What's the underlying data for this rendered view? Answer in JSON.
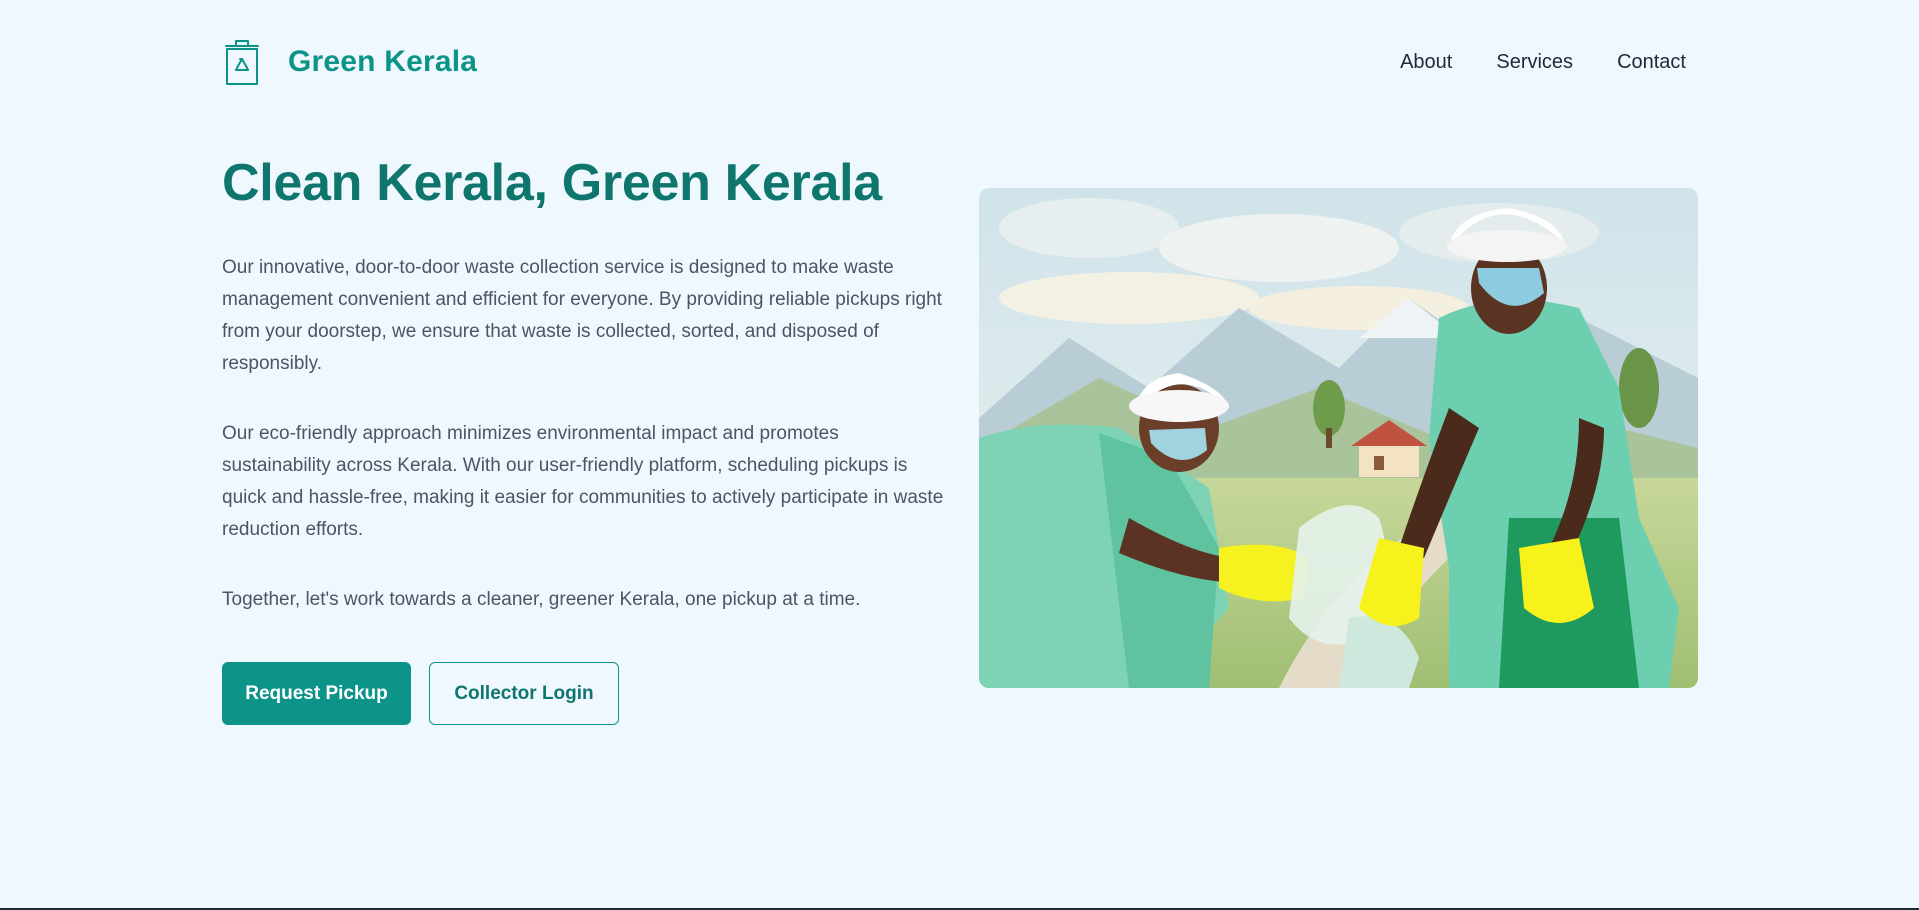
{
  "brand": {
    "name": "Green Kerala",
    "icon": "recycle-bin-icon",
    "color": "#0d9488"
  },
  "nav": {
    "items": [
      "About",
      "Services",
      "Contact"
    ]
  },
  "hero": {
    "title": "Clean Kerala, Green Kerala",
    "paragraphs": [
      "Our innovative, door-to-door waste collection service is designed to make waste management convenient and efficient for everyone. By providing reliable pickups right from your doorstep, we ensure that waste is collected, sorted, and disposed of responsibly.",
      "Our eco-friendly approach minimizes environmental impact and promotes sustainability across Kerala. With our user-friendly platform, scheduling pickups is quick and hassle-free, making it easier for communities to actively participate in waste reduction efforts.",
      "Together, let's work towards a cleaner, greener Kerala, one pickup at a time."
    ],
    "primary_button": "Request Pickup",
    "secondary_button": "Collector Login",
    "image": "waste-collectors-illustration"
  },
  "colors": {
    "background": "#f0f8ff",
    "accent": "#0d9488",
    "title": "#0f766e",
    "text": "#4b5563"
  }
}
